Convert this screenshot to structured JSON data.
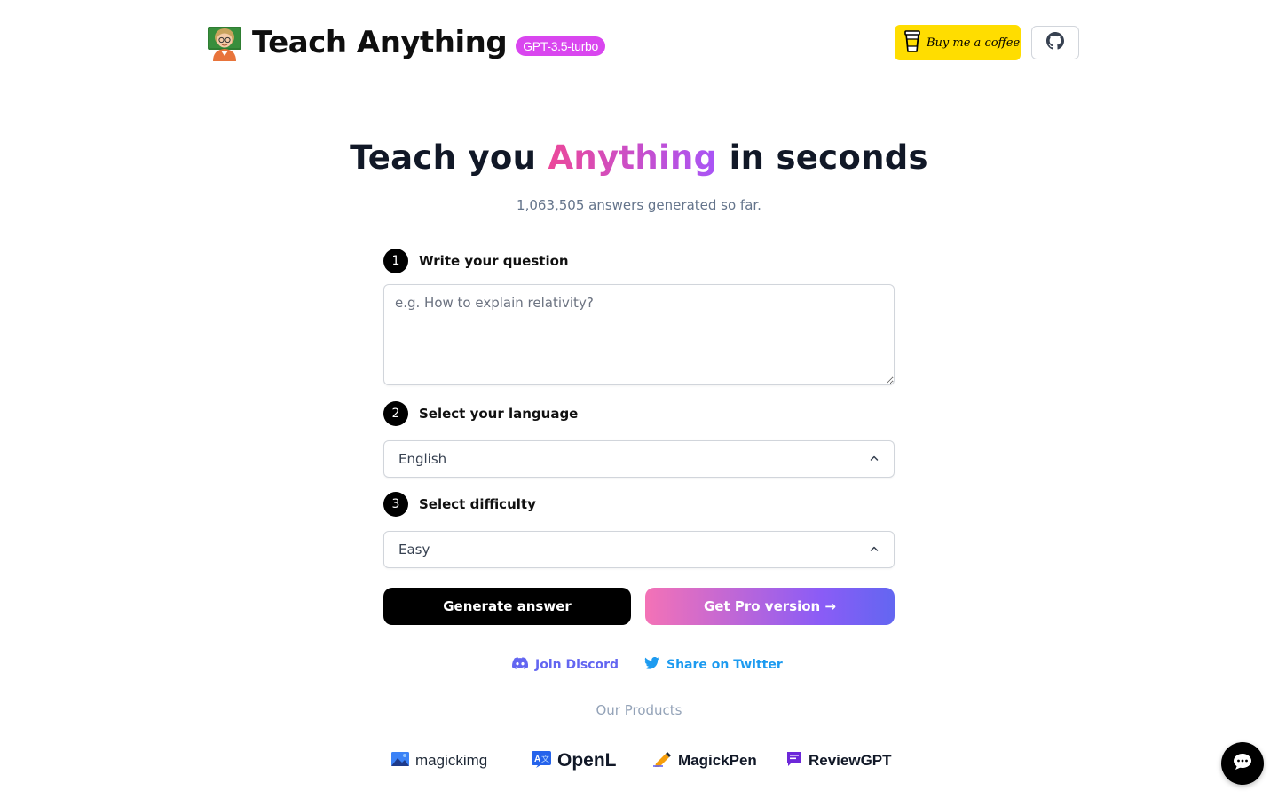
{
  "header": {
    "brand_title": "Teach Anything",
    "model_badge": "GPT-3.5-turbo",
    "coffee_label": "Buy me a coffee",
    "icons": {
      "brand": "teacher-emoji-icon",
      "coffee": "coffee-cup-icon",
      "github": "github-icon"
    }
  },
  "hero": {
    "title_before": "Teach you ",
    "title_highlight": "Anything",
    "title_after": " in seconds",
    "subtitle": "1,063,505 answers generated so far."
  },
  "form": {
    "step1": {
      "num": "1",
      "label": "Write your question",
      "placeholder": "e.g. How to explain relativity?",
      "value": ""
    },
    "step2": {
      "num": "2",
      "label": "Select your language",
      "selected": "English"
    },
    "step3": {
      "num": "3",
      "label": "Select difficulty",
      "selected": "Easy"
    }
  },
  "actions": {
    "generate_label": "Generate answer",
    "pro_label": "Get Pro version →"
  },
  "social": {
    "discord_label": "Join Discord",
    "twitter_label": "Share on Twitter"
  },
  "products": {
    "title": "Our Products",
    "items": [
      {
        "name": "magickimg",
        "icon": "image-icon"
      },
      {
        "name": "OpenL",
        "icon": "translate-icon"
      },
      {
        "name": "MagickPen",
        "icon": "pen-icon"
      },
      {
        "name": "ReviewGPT",
        "icon": "chat-bubble-icon"
      }
    ]
  },
  "colors": {
    "accent_pink": "#ec4899",
    "accent_purple": "#a855f7",
    "badge": "#d946ef",
    "coffee_yellow": "#ffdd00",
    "discord": "#6366f1",
    "twitter": "#1d9bf0"
  }
}
